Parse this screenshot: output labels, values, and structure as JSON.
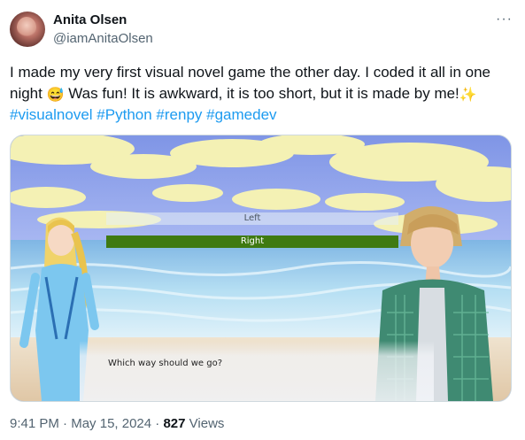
{
  "author": {
    "name": "Anita Olsen",
    "handle": "@iamAnitaOlsen"
  },
  "more_menu": "···",
  "tweet": {
    "text_part1": "I made my very first visual novel game the other day. I coded it all in one night",
    "emoji1": "😅",
    "text_part2": " Was fun! It is awkward, it is too short, but it is made by me!",
    "emoji2": "✨",
    "hashtags": [
      "#visualnovel",
      "#Python",
      "#renpy",
      "#gamedev"
    ]
  },
  "game": {
    "choices": [
      "Left",
      "Right"
    ],
    "dialogue": "Which way should we go?",
    "colors": {
      "sky": "#8fa6ec",
      "cloud": "#f3f1b8",
      "sea": "#9fd0ee",
      "sand": "#ead7bd",
      "selected_choice": "#3f7a12"
    }
  },
  "meta": {
    "time": "9:41 PM",
    "date": "May 15, 2024",
    "views_count": "827",
    "views_label": "Views"
  }
}
